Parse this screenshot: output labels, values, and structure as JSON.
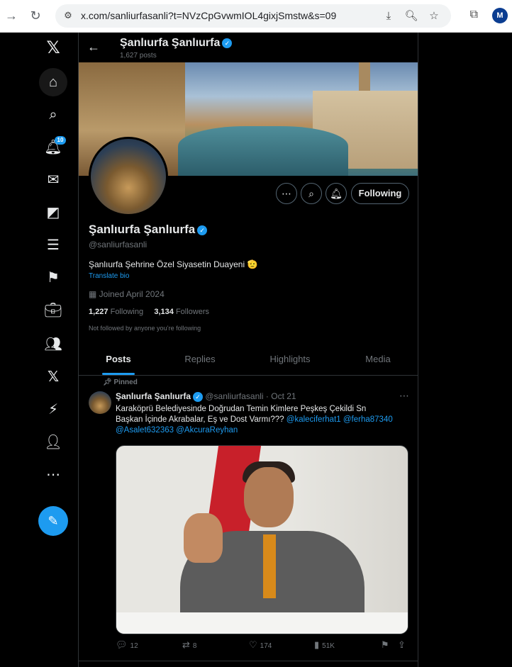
{
  "browser": {
    "url": "x.com/sanliurfasanli?t=NVzCpGvwmIOL4gixjSmstw&s=09",
    "profile_initial": "M",
    "icons": [
      "back-arrow-icon",
      "refresh-icon",
      "site-settings-icon",
      "install-icon",
      "zoom-icon",
      "star-icon",
      "extensions-icon"
    ]
  },
  "nav": {
    "items": [
      "x-logo",
      "home",
      "search",
      "notifications",
      "messages",
      "grok",
      "lists",
      "bookmarks",
      "jobs",
      "communities",
      "premium",
      "verified-orgs",
      "profile",
      "more"
    ],
    "notification_count": "10"
  },
  "header": {
    "name": "Şanlıurfa Şanlıurfa",
    "posts_count": "1,627 posts"
  },
  "profile": {
    "name": "Şanlıurfa Şanlıurfa",
    "handle": "@sanliurfasanli",
    "bio": "Şanlıurfa Şehrine Özel  Siyasetin Duayeni 🫡",
    "translate": "Translate bio",
    "joined": "Joined April 2024",
    "following_count": "1,227",
    "following_label": "Following",
    "followers_count": "3,134",
    "followers_label": "Followers",
    "not_followed": "Not followed by anyone you’re following",
    "following_button": "Following"
  },
  "tabs": [
    "Posts",
    "Replies",
    "Highlights",
    "Media"
  ],
  "tweet": {
    "pinned_label": "Pinned",
    "author": "Şanlıurfa Şanlıurfa",
    "handle_time": "@sanliurfasanli · Oct 21",
    "text_line1": "Karaköprü Belediyesinde Doğrudan Temin Kimlere Peşkeş Çekildi Sn",
    "text_line2_plain": "Başkan İçinde Akrabalar, Eş ve Dost Varmı???",
    "mention1": "@kaleciferhat1",
    "mention2": "@ferha87340",
    "mention3": "@Asalet632363",
    "mention4": "@AkcuraReyhan",
    "replies": "12",
    "reposts": "8",
    "likes": "174",
    "views": "51K"
  },
  "colors": {
    "accent": "#1d9bf0",
    "background": "#000000",
    "border": "#2f3336",
    "muted": "#71767b"
  }
}
